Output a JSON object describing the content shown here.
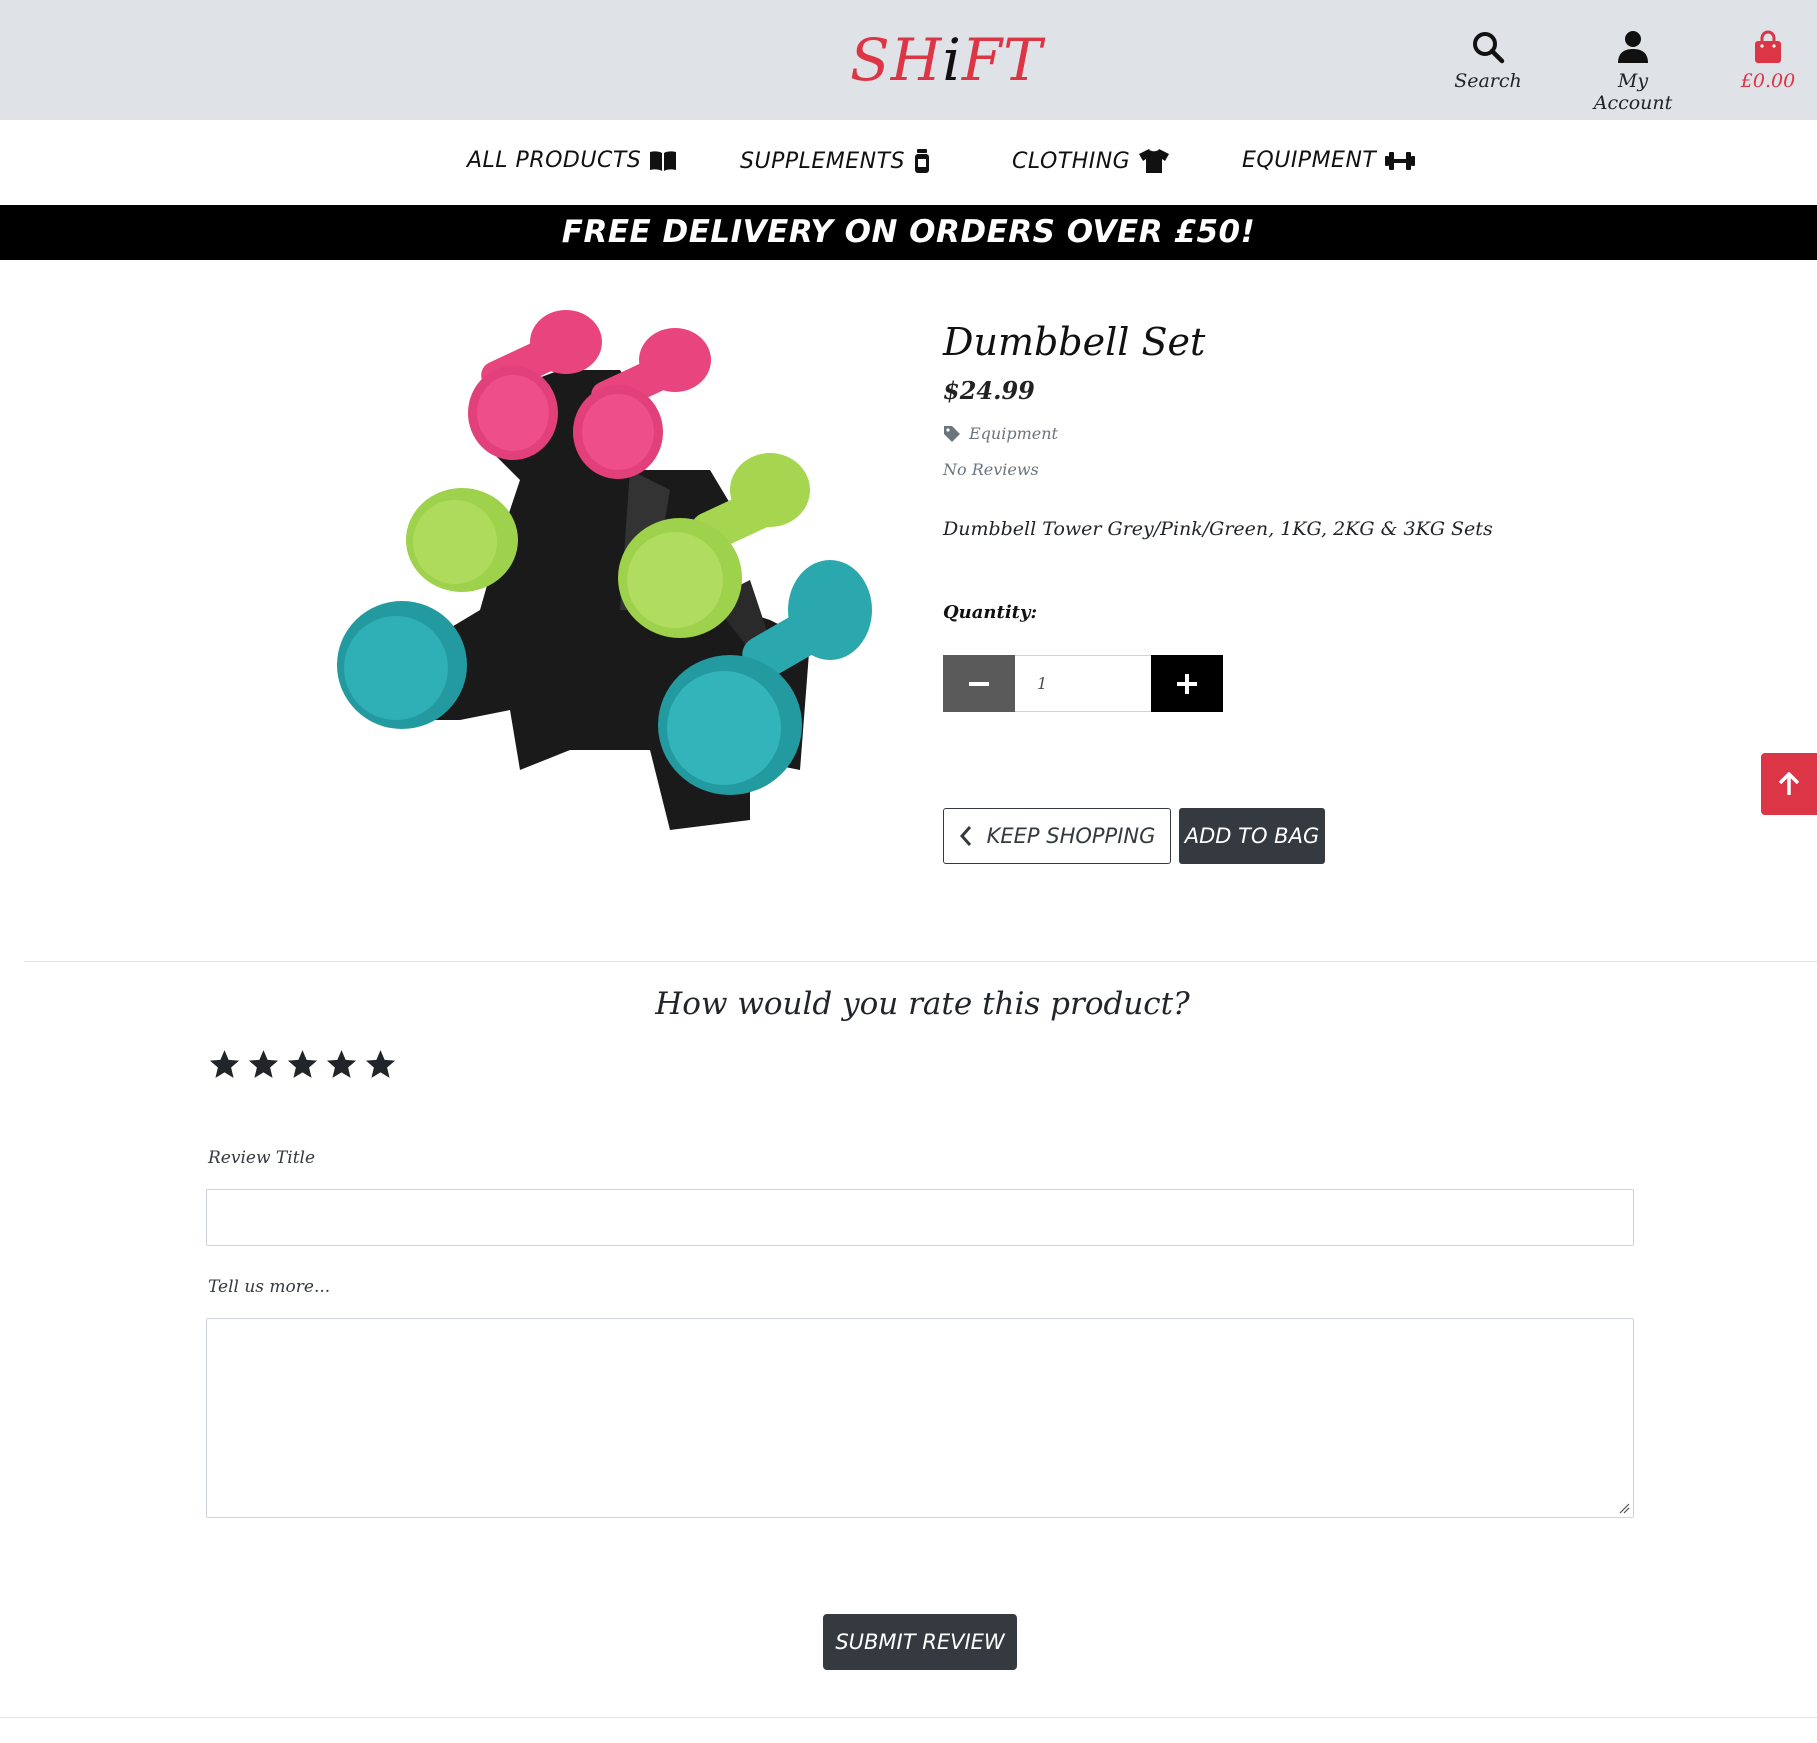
{
  "brand": {
    "logo_pre": "SH",
    "logo_i": "i",
    "logo_post": "FT",
    "accent": "#dc3545"
  },
  "header": {
    "search_label": "Search",
    "account_label": "My Account",
    "bag_total": "£0.00",
    "icons": [
      "search-icon",
      "user-icon",
      "shopping-bag-icon"
    ]
  },
  "nav": {
    "items": [
      {
        "label": "ALL PRODUCTS",
        "icon": "book-open-icon"
      },
      {
        "label": "SUPPLEMENTS",
        "icon": "jar-icon"
      },
      {
        "label": "CLOTHING",
        "icon": "tshirt-icon"
      },
      {
        "label": "EQUIPMENT",
        "icon": "dumbbell-icon"
      }
    ]
  },
  "banner": {
    "text": "FREE DELIVERY ON ORDERS OVER £50!"
  },
  "product": {
    "name": "Dumbbell Set",
    "price": "$24.99",
    "category": "Equipment",
    "reviews": "No Reviews",
    "description": "Dumbbell Tower Grey/Pink/Green, 1KG, 2KG & 3KG Sets",
    "image_alt": "dumbbell-set-image"
  },
  "quantity": {
    "label": "Quantity:",
    "value": "1"
  },
  "actions": {
    "keep_shopping": "KEEP SHOPPING",
    "add_to_bag": "ADD TO BAG"
  },
  "review": {
    "heading": "How would you rate this product?",
    "stars": 5,
    "title_label": "Review Title",
    "title_value": "",
    "body_label": "Tell us more...",
    "body_value": "",
    "submit": "SUBMIT REVIEW"
  }
}
